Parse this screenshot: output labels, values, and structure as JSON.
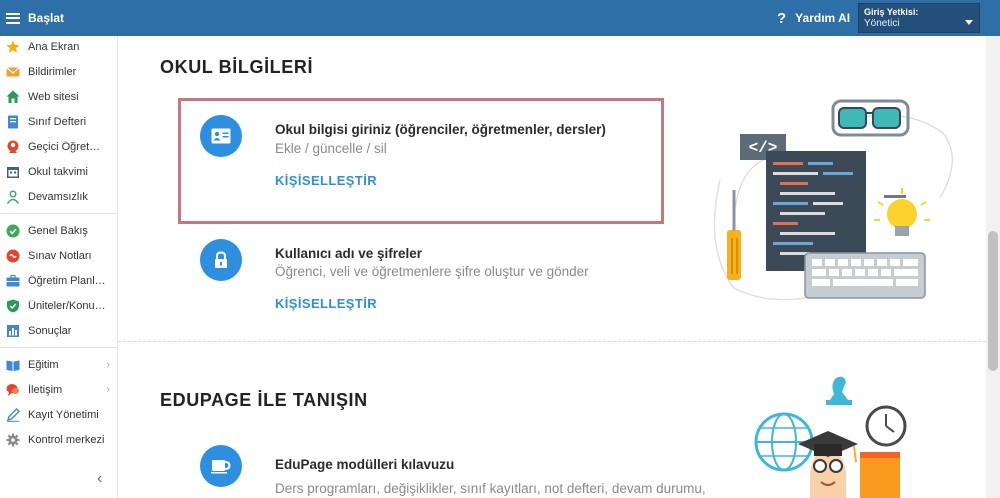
{
  "topbar": {
    "menu_label": "Başlat",
    "help_icon": "?",
    "help_label": "Yardım AI",
    "role_label": "Giriş Yetkisi:",
    "role_value": "Yönetici"
  },
  "sidebar": {
    "items": [
      {
        "label": "Ana Ekran",
        "icon": "star-icon",
        "color": "#f2b400"
      },
      {
        "label": "Bildirimler",
        "icon": "envelope-icon",
        "color": "#f0a030"
      },
      {
        "label": "Web sitesi",
        "icon": "house-icon",
        "color": "#2a9a58"
      },
      {
        "label": "Sınıf Defteri",
        "icon": "notebook-icon",
        "color": "#3f88d6"
      },
      {
        "label": "Geçici Öğretmen",
        "icon": "person-icon",
        "color": "#e0462a"
      },
      {
        "label": "Okul takvimi",
        "icon": "calendar-icon",
        "color": "#4a5f78"
      },
      {
        "label": "Devamsızlık",
        "icon": "person-outline-icon",
        "color": "#3ca85a"
      },
      {
        "label": "Genel Bakış",
        "icon": "check-circle-icon",
        "color": "#3ca85a"
      },
      {
        "label": "Sınav Notları",
        "icon": "grade-icon",
        "color": "#e5452c"
      },
      {
        "label": "Öğretim Planları",
        "icon": "briefcase-icon",
        "color": "#3f88d6"
      },
      {
        "label": "Üniteler/Konular",
        "icon": "shield-check-icon",
        "color": "#2a9a58"
      },
      {
        "label": "Sonuçlar",
        "icon": "bar-chart-icon",
        "color": "#3f88d6"
      },
      {
        "label": "Eğitim",
        "icon": "book-icon",
        "color": "#3f88d6",
        "chevron": "›"
      },
      {
        "label": "İletişim",
        "icon": "chat-icon",
        "color": "#e5452c",
        "chevron": "›"
      },
      {
        "label": "Kayıt Yönetimi",
        "icon": "pen-icon",
        "color": "#3f88d6"
      },
      {
        "label": "Kontrol merkezi",
        "icon": "gear-icon",
        "color": "#8a8a8a"
      }
    ],
    "collapse_icon": "‹"
  },
  "main": {
    "section1_title": "OKUL BİLGİLERİ",
    "item1": {
      "title": "Okul bilgisi giriniz (öğrenciler, öğretmenler, dersler)",
      "subtitle": "Ekle / güncelle / sil",
      "action": "KİŞİSELLEŞTİR"
    },
    "item2": {
      "title": "Kullanıcı adı ve şifreler",
      "subtitle": "Öğrenci, veli ve öğretmenlere şifre oluştur ve gönder",
      "action": "KİŞİSELLEŞTİR"
    },
    "section2_title": "EDUPAGE İLE TANIŞIN",
    "item3": {
      "title": "EduPage modülleri kılavuzu",
      "subtitle": "Ders programları, değişiklikler, sınıf kayıtları, not defteri, devam durumu,"
    },
    "illustration_code_tag": "</>"
  }
}
